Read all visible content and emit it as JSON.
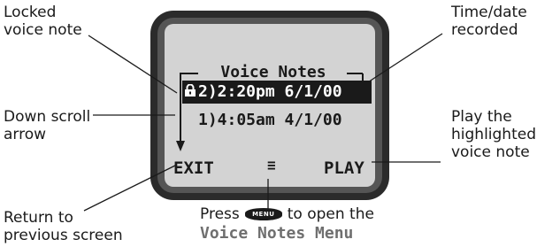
{
  "callouts": {
    "locked_voice_note": [
      "Locked",
      "voice note"
    ],
    "time_date_recorded": [
      "Time/date",
      "recorded"
    ],
    "down_scroll_arrow": [
      "Down scroll",
      "arrow"
    ],
    "play_highlighted": [
      "Play the",
      "highlighted",
      "voice note"
    ],
    "return_previous": [
      "Return to",
      "previous screen"
    ]
  },
  "screen": {
    "title": "Voice Notes",
    "rows": [
      {
        "index": "2)",
        "time": "2:20pm",
        "date": "6/1/00",
        "locked": true,
        "highlighted": true
      },
      {
        "index": "1)",
        "time": "4:05am",
        "date": "4/1/00",
        "locked": false,
        "highlighted": false
      }
    ],
    "row1_text": "2)2:20pm 6/1/00",
    "row2_text": "1)4:05am 4/1/00",
    "left_softkey": "EXIT",
    "right_softkey": "PLAY",
    "menu_indicator": "≡"
  },
  "footer": {
    "press_text": "Press",
    "key_label": "MENU",
    "after_key_text": "to open the",
    "menu_name": "Voice Notes Menu"
  },
  "colors": {
    "screen_bg": "#d3d3d3",
    "highlight_bg": "#1a1a1a",
    "menu_name_color": "#6f6f6f",
    "bezel": "#2b2b2b"
  }
}
